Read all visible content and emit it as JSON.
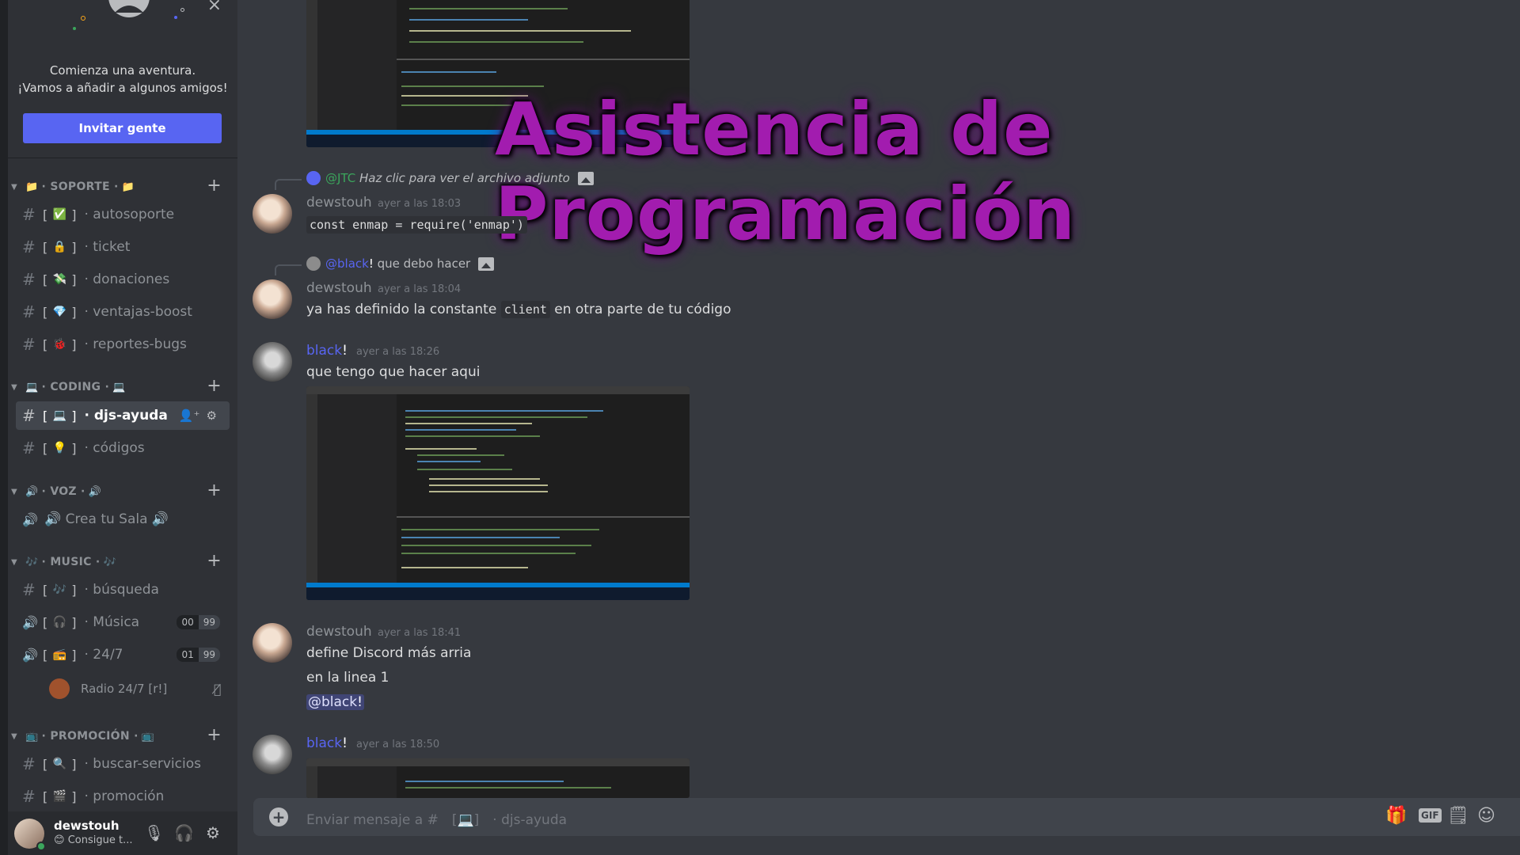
{
  "welcome": {
    "line1": "Comienza una aventura.",
    "line2": "¡Vamos a añadir a algunos amigos!",
    "invite_button": "Invitar gente"
  },
  "categories": [
    {
      "label": "SOPORTE",
      "sep": "·"
    },
    {
      "label": "CODING",
      "sep": "·"
    },
    {
      "label": "VOZ",
      "sep": "·"
    },
    {
      "label": "MUSIC",
      "sep": "·"
    },
    {
      "label": "PROMOCIÓN",
      "sep": "·"
    }
  ],
  "channels": {
    "autosoporte": {
      "icon": "#",
      "emoji": "✅",
      "name": "· autosoporte"
    },
    "ticket": {
      "icon": "#",
      "emoji": "🔒",
      "name": "· ticket"
    },
    "donaciones": {
      "icon": "#",
      "emoji": "💸",
      "name": "· donaciones"
    },
    "ventajas_boost": {
      "icon": "#",
      "emoji": "💎",
      "name": "· ventajas-boost"
    },
    "reportes_bugs": {
      "icon": "#",
      "emoji": "🐞",
      "name": "· reportes-bugs"
    },
    "djs_ayuda": {
      "icon": "#",
      "emoji": "💻",
      "name": "· djs-ayuda"
    },
    "codigos": {
      "icon": "#",
      "emoji": "💡",
      "name": "· códigos"
    },
    "crea_tu_sala": {
      "icon": "🔊",
      "name": "🔊 Crea tu Sala 🔊"
    },
    "busqueda": {
      "icon": "#",
      "emoji": "🎶",
      "name": "· búsqueda"
    },
    "musica": {
      "icon": "🔊",
      "emoji": "🎧",
      "name": "· Música",
      "count_a": "00",
      "count_b": "99"
    },
    "radio_247": {
      "icon": "🔊",
      "emoji": "📻",
      "name": "· 24/7",
      "count_a": "01",
      "count_b": "99"
    },
    "buscar_servicios": {
      "icon": "#",
      "emoji": "🔍",
      "name": "· buscar-servicios"
    },
    "promocion": {
      "icon": "#",
      "emoji": "🎬",
      "name": "· promoción"
    }
  },
  "voice_user": {
    "name": "Radio 24/7 [r!]"
  },
  "user_panel": {
    "username": "dewstouh",
    "status": "Consigue t..."
  },
  "banner": {
    "text": "Asistencia de Programación"
  },
  "messages": {
    "m1": {
      "reply_user": "@JTC",
      "reply_text": "Haz clic para ver el archivo adjunto",
      "author": "dewstouh",
      "timestamp": "ayer a las 18:03",
      "code": "const enmap = require('enmap')"
    },
    "m2": {
      "reply_user": "@black",
      "reply_bang": "!",
      "reply_text": "que debo hacer",
      "author": "dewstouh",
      "timestamp": "ayer a las 18:04",
      "text_before": "ya has definido la constante",
      "code": "client",
      "text_after": "en otra parte de tu código"
    },
    "m3": {
      "author": "black",
      "bang": "!",
      "timestamp": "ayer a las 18:26",
      "text": "que tengo que hacer aqui"
    },
    "m4": {
      "author": "dewstouh",
      "timestamp": "ayer a las 18:41",
      "line1": "define Discord más arria",
      "line2": "en la linea 1",
      "mention": "@black"
    },
    "m5": {
      "author": "black",
      "bang": "!",
      "timestamp": "ayer a las 18:50"
    }
  },
  "composer": {
    "placeholder": "Enviar mensaje a #　[💻]　· djs-ayuda"
  },
  "colors": {
    "accent": "#5865f2",
    "banner": "#a21caf",
    "online": "#3ba55c"
  }
}
